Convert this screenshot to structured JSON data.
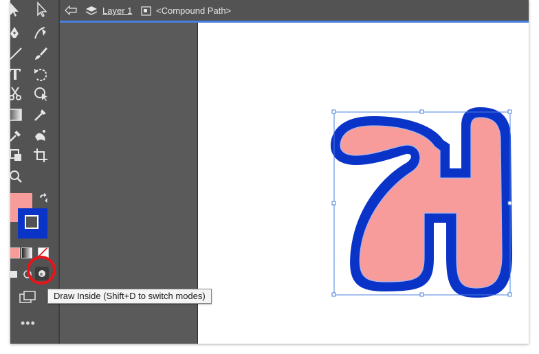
{
  "breadcrumb": {
    "layer": "Layer 1",
    "object": "<Compound Path>"
  },
  "tooltip": {
    "text": "Draw Inside (Shift+D to switch modes)"
  },
  "toolbar": {
    "more_label": "•••",
    "tools": [
      "selection-icon",
      "direct-selection-icon",
      "pen-icon",
      "curvature-icon",
      "line-icon",
      "brush-icon",
      "type-icon",
      "rotate-icon",
      "scissors-icon",
      "shape-builder-icon",
      "gradient-icon",
      "eyedropper-icon",
      "symbol-sprayer-icon",
      "artboard-icon",
      "zoom-icon"
    ]
  },
  "colors": {
    "fill": "#f79c9a",
    "stroke": "#0a33c8",
    "accent": "#4a7fe0",
    "highlight": "#e8141a"
  },
  "canvas": {
    "artwork": "compound-path-letter-shape"
  }
}
